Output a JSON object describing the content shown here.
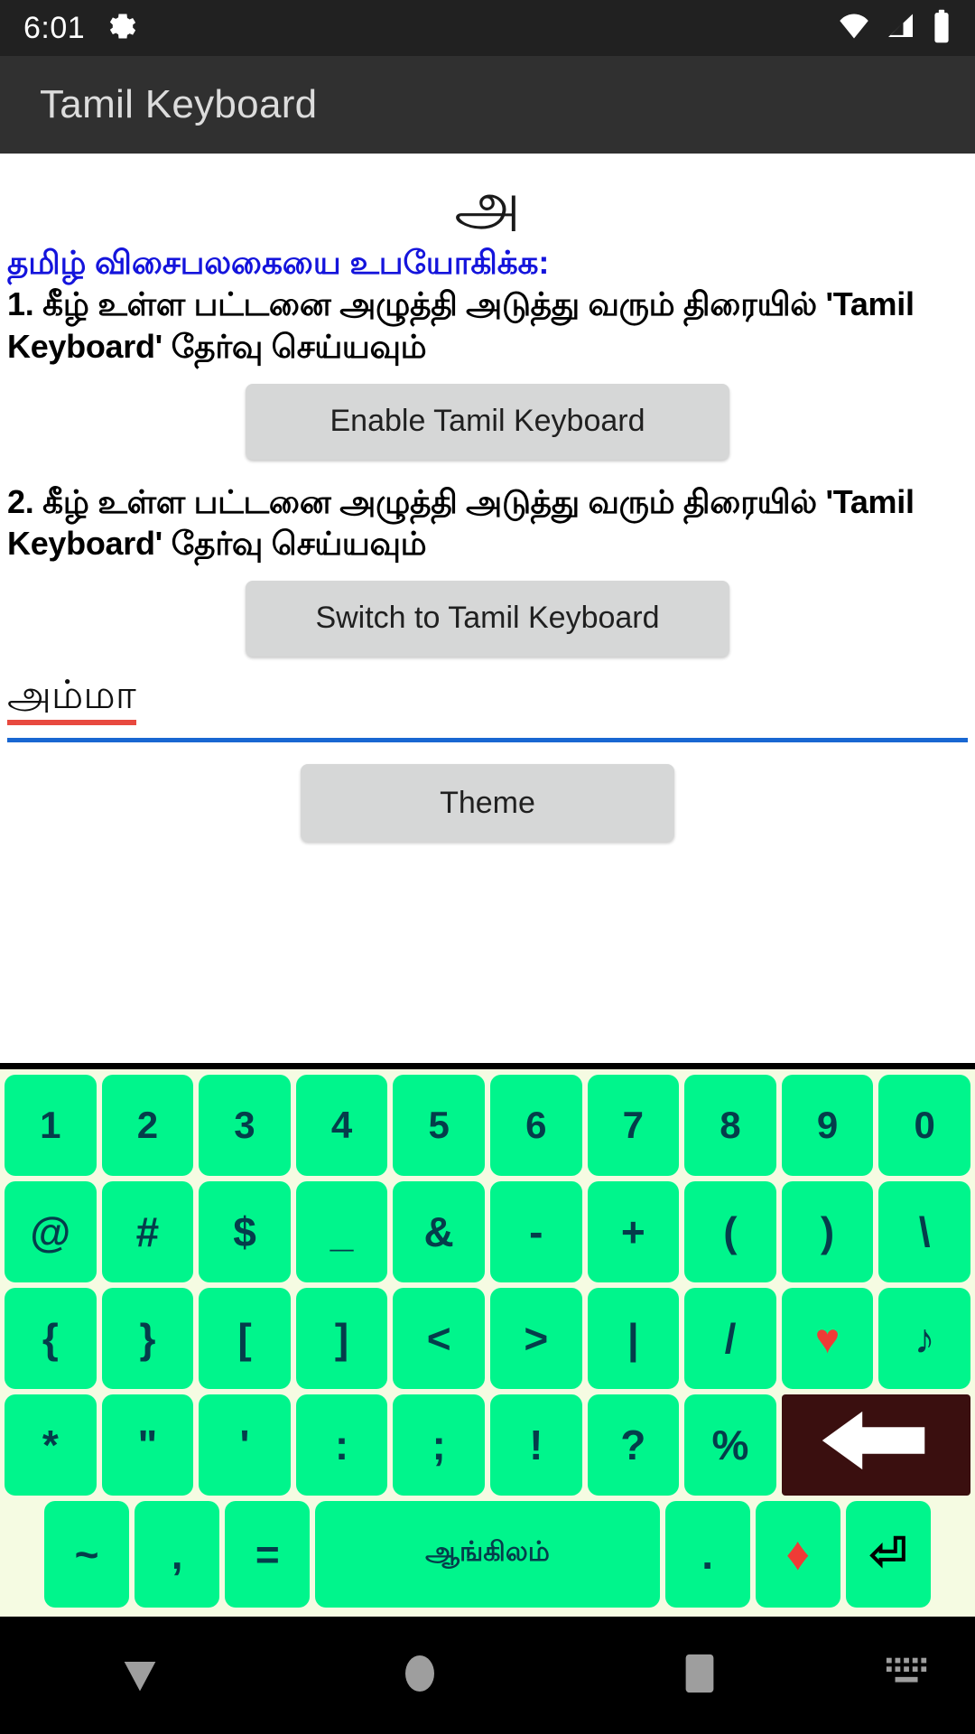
{
  "status_bar": {
    "time": "6:01",
    "icons": [
      "gear-icon",
      "wifi-icon",
      "signal-icon",
      "battery-icon"
    ]
  },
  "app_bar": {
    "title": "Tamil Keyboard"
  },
  "main": {
    "logo_glyph": "அ",
    "heading": "தமிழ் விசைபலகையை உபயோகிக்க:",
    "instruction_1": "1. கீழ் உள்ள பட்டனை அழுத்தி அடுத்து வரும் திரையில் 'Tamil Keyboard' தேர்வு செய்யவும்",
    "enable_button": "Enable Tamil Keyboard",
    "instruction_2": "2. கீழ் உள்ள பட்டனை அழுத்தி அடுத்து வரும் திரையில் 'Tamil Keyboard' தேர்வு செய்யவும்",
    "switch_button": "Switch to Tamil Keyboard",
    "input_value": "அம்மா",
    "theme_button": "Theme"
  },
  "keyboard": {
    "key_bg": "#00f58c",
    "key_text_color": "#053d4b",
    "board_bg": "#f5fbe2",
    "row1": [
      "1",
      "2",
      "3",
      "4",
      "5",
      "6",
      "7",
      "8",
      "9",
      "0"
    ],
    "row2": [
      "@",
      "#",
      "$",
      "_",
      "&",
      "-",
      "+",
      "(",
      ")",
      "\\"
    ],
    "row3": [
      "{",
      "}",
      "[",
      "]",
      "<",
      ">",
      "|",
      "/",
      "♥",
      "♪"
    ],
    "row4": [
      "*",
      "\"",
      "'",
      ":",
      ";",
      "!",
      "?",
      "%"
    ],
    "backspace_label": "⬅",
    "row5": {
      "tilde": "~",
      "comma": ",",
      "equals": "=",
      "space_label": "ஆங்கிலம்",
      "period": ".",
      "diamond": "♦",
      "enter": "⏎"
    }
  },
  "nav_bar": {
    "back": "back-icon",
    "home": "home-icon",
    "recents": "recents-icon",
    "keyboard": "keyboard-icon"
  }
}
